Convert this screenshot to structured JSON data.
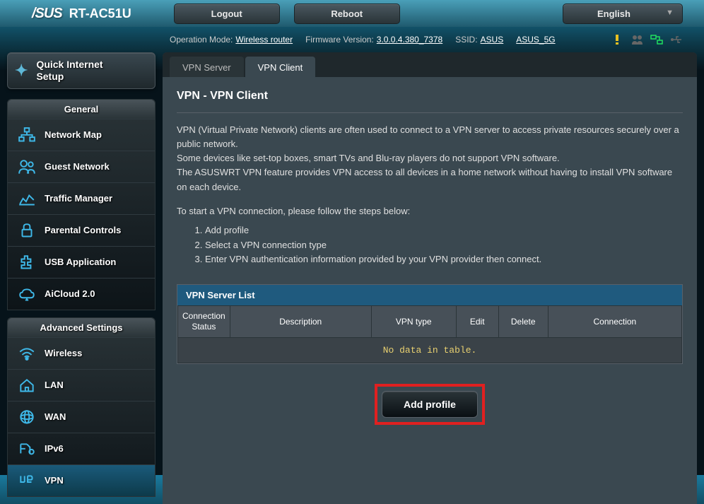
{
  "top": {
    "brand": "/SUS",
    "model": "RT-AC51U",
    "logout": "Logout",
    "reboot": "Reboot",
    "lang": "English"
  },
  "status": {
    "op_mode_lbl": "Operation Mode:",
    "op_mode_val": "Wireless router",
    "fw_lbl": "Firmware Version:",
    "fw_val": "3.0.0.4.380_7378",
    "ssid_lbl": "SSID:",
    "ssid_val1": "ASUS",
    "ssid_val2": "ASUS_5G"
  },
  "qis": {
    "line1": "Quick Internet",
    "line2": "Setup"
  },
  "general": {
    "header": "General",
    "items": [
      {
        "label": "Network Map"
      },
      {
        "label": "Guest Network"
      },
      {
        "label": "Traffic Manager"
      },
      {
        "label": "Parental Controls"
      },
      {
        "label": "USB Application"
      },
      {
        "label": "AiCloud 2.0"
      }
    ]
  },
  "advanced": {
    "header": "Advanced Settings",
    "items": [
      {
        "label": "Wireless"
      },
      {
        "label": "LAN"
      },
      {
        "label": "WAN"
      },
      {
        "label": "IPv6"
      },
      {
        "label": "VPN"
      }
    ]
  },
  "tabs": {
    "server": "VPN Server",
    "client": "VPN Client"
  },
  "page": {
    "title": "VPN - VPN Client",
    "desc1": "VPN (Virtual Private Network) clients are often used to connect to a VPN server to access private resources securely over a public network.",
    "desc2": "Some devices like set-top boxes, smart TVs and Blu-ray players do not support VPN software.",
    "desc3": "The ASUSWRT VPN feature provides VPN access to all devices in a home network without having to install VPN software on each device.",
    "follow": "To start a VPN connection, please follow the steps below:",
    "step1": "Add profile",
    "step2": "Select a VPN connection type",
    "step3": "Enter VPN authentication information provided by your VPN provider then connect.",
    "list_header": "VPN Server List",
    "cols": {
      "conn_status": "Connection Status",
      "description": "Description",
      "vpn_type": "VPN type",
      "edit": "Edit",
      "delete": "Delete",
      "connection": "Connection"
    },
    "empty": "No data in table.",
    "add_profile": "Add profile"
  }
}
